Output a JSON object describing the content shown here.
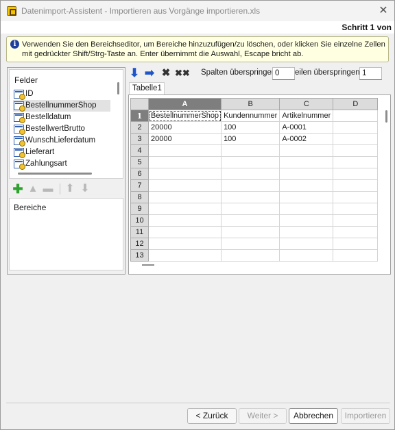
{
  "window": {
    "title": "Datenimport-Assistent -  Importieren aus  Vorgänge importieren.xls",
    "close_glyph": "✕",
    "step_label": "Schritt 1 von"
  },
  "info": {
    "icon": "info-icon",
    "text": "Verwenden Sie den Bereichseditor, um Bereiche hinzuzufügen/zu löschen, oder klicken Sie einzelne Zellen mit gedrückter Shift/Strg-Taste an. Enter übernimmt die Auswahl, Escape bricht ab."
  },
  "fields": {
    "header": "Felder",
    "items": [
      "ID",
      "BestellnummerShop",
      "Bestelldatum",
      "BestellwertBrutto",
      "WunschLieferdatum",
      "Lieferart",
      "Zahlungsart"
    ],
    "selected": "BestellnummerShop"
  },
  "bereiche": {
    "header": "Bereiche"
  },
  "toolbar": {
    "skip_columns_label": "Spalten überspringen",
    "skip_columns_value": "0",
    "skip_rows_label": "eilen überspringen",
    "skip_rows_value": "1"
  },
  "sheet": {
    "tab": "Tabelle1",
    "columns": [
      "A",
      "B",
      "C",
      "D"
    ],
    "selected_column": "A",
    "rows": [
      {
        "n": "1",
        "cells": [
          "BestellnummerShop",
          "Kundennummer",
          "Artikelnummer",
          ""
        ]
      },
      {
        "n": "2",
        "cells": [
          "20000",
          "100",
          "A-0001",
          ""
        ]
      },
      {
        "n": "3",
        "cells": [
          "20000",
          "100",
          "A-0002",
          ""
        ]
      },
      {
        "n": "4",
        "cells": [
          "",
          "",
          "",
          ""
        ]
      },
      {
        "n": "5",
        "cells": [
          "",
          "",
          "",
          ""
        ]
      },
      {
        "n": "6",
        "cells": [
          "",
          "",
          "",
          ""
        ]
      },
      {
        "n": "7",
        "cells": [
          "",
          "",
          "",
          ""
        ]
      },
      {
        "n": "8",
        "cells": [
          "",
          "",
          "",
          ""
        ]
      },
      {
        "n": "9",
        "cells": [
          "",
          "",
          "",
          ""
        ]
      },
      {
        "n": "10",
        "cells": [
          "",
          "",
          "",
          ""
        ]
      },
      {
        "n": "11",
        "cells": [
          "",
          "",
          "",
          ""
        ]
      },
      {
        "n": "12",
        "cells": [
          "",
          "",
          "",
          ""
        ]
      },
      {
        "n": "13",
        "cells": [
          "",
          "",
          "",
          ""
        ]
      }
    ]
  },
  "buttons": {
    "back": "< Zurück",
    "next": "Weiter >",
    "cancel": "Abbrechen",
    "import": "Importieren"
  }
}
